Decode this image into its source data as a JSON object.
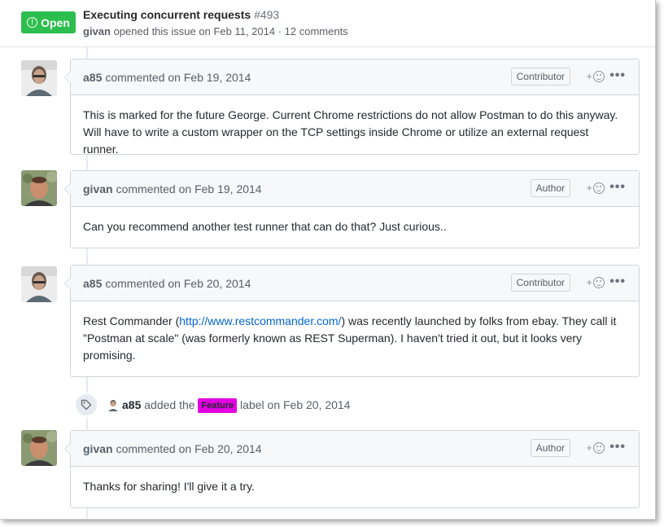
{
  "header": {
    "status_label": "Open",
    "status_color": "#2cbe4e",
    "title": "Executing concurrent requests",
    "number": "#493",
    "author": "givan",
    "meta_text": " opened this issue on Feb 11, 2014 · 12 comments"
  },
  "comments": [
    {
      "author": "a85",
      "meta": "commented on Feb 19, 2014",
      "role": "Contributor",
      "body": "This is marked for the future George. Current Chrome restrictions do not allow Postman to do this anyway. Will have to write a custom wrapper on the TCP settings inside Chrome or utilize an external request runner."
    },
    {
      "author": "givan",
      "meta": "commented on Feb 19, 2014",
      "role": "Author",
      "body": "Can you recommend another test runner that can do that? Just curious.."
    },
    {
      "author": "a85",
      "meta": "commented on Feb 20, 2014",
      "role": "Contributor",
      "body_before": "Rest Commander (",
      "link": "http://www.restcommander.com/",
      "body_after": ") was recently launched by folks from ebay. They call it \"Postman at scale\" (was formerly known as REST Superman). I haven't tried it out, but it looks very promising."
    },
    {
      "author": "givan",
      "meta": "commented on Feb 20, 2014",
      "role": "Author",
      "body": "Thanks for sharing! I'll give it a try."
    }
  ],
  "event": {
    "actor": "a85",
    "action": " added the ",
    "label": "Feature",
    "label_color": "#e200e2",
    "suffix": " label on Feb 20, 2014"
  },
  "icons": [
    "alert-circle-icon",
    "tag-icon",
    "smiley-icon",
    "kebab-icon"
  ]
}
